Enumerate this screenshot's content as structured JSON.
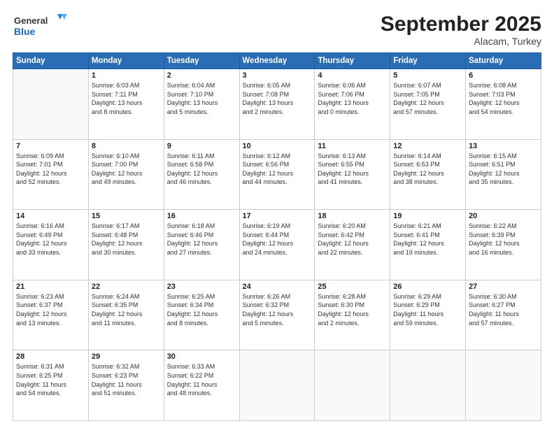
{
  "header": {
    "logo_line1": "General",
    "logo_line2": "Blue",
    "month": "September 2025",
    "location": "Alacam, Turkey"
  },
  "days_of_week": [
    "Sunday",
    "Monday",
    "Tuesday",
    "Wednesday",
    "Thursday",
    "Friday",
    "Saturday"
  ],
  "weeks": [
    [
      {
        "day": "",
        "info": ""
      },
      {
        "day": "1",
        "info": "Sunrise: 6:03 AM\nSunset: 7:11 PM\nDaylight: 13 hours\nand 8 minutes."
      },
      {
        "day": "2",
        "info": "Sunrise: 6:04 AM\nSunset: 7:10 PM\nDaylight: 13 hours\nand 5 minutes."
      },
      {
        "day": "3",
        "info": "Sunrise: 6:05 AM\nSunset: 7:08 PM\nDaylight: 13 hours\nand 2 minutes."
      },
      {
        "day": "4",
        "info": "Sunrise: 6:06 AM\nSunset: 7:06 PM\nDaylight: 13 hours\nand 0 minutes."
      },
      {
        "day": "5",
        "info": "Sunrise: 6:07 AM\nSunset: 7:05 PM\nDaylight: 12 hours\nand 57 minutes."
      },
      {
        "day": "6",
        "info": "Sunrise: 6:08 AM\nSunset: 7:03 PM\nDaylight: 12 hours\nand 54 minutes."
      }
    ],
    [
      {
        "day": "7",
        "info": "Sunrise: 6:09 AM\nSunset: 7:01 PM\nDaylight: 12 hours\nand 52 minutes."
      },
      {
        "day": "8",
        "info": "Sunrise: 6:10 AM\nSunset: 7:00 PM\nDaylight: 12 hours\nand 49 minutes."
      },
      {
        "day": "9",
        "info": "Sunrise: 6:11 AM\nSunset: 6:58 PM\nDaylight: 12 hours\nand 46 minutes."
      },
      {
        "day": "10",
        "info": "Sunrise: 6:12 AM\nSunset: 6:56 PM\nDaylight: 12 hours\nand 44 minutes."
      },
      {
        "day": "11",
        "info": "Sunrise: 6:13 AM\nSunset: 6:55 PM\nDaylight: 12 hours\nand 41 minutes."
      },
      {
        "day": "12",
        "info": "Sunrise: 6:14 AM\nSunset: 6:53 PM\nDaylight: 12 hours\nand 38 minutes."
      },
      {
        "day": "13",
        "info": "Sunrise: 6:15 AM\nSunset: 6:51 PM\nDaylight: 12 hours\nand 35 minutes."
      }
    ],
    [
      {
        "day": "14",
        "info": "Sunrise: 6:16 AM\nSunset: 6:49 PM\nDaylight: 12 hours\nand 33 minutes."
      },
      {
        "day": "15",
        "info": "Sunrise: 6:17 AM\nSunset: 6:48 PM\nDaylight: 12 hours\nand 30 minutes."
      },
      {
        "day": "16",
        "info": "Sunrise: 6:18 AM\nSunset: 6:46 PM\nDaylight: 12 hours\nand 27 minutes."
      },
      {
        "day": "17",
        "info": "Sunrise: 6:19 AM\nSunset: 6:44 PM\nDaylight: 12 hours\nand 24 minutes."
      },
      {
        "day": "18",
        "info": "Sunrise: 6:20 AM\nSunset: 6:42 PM\nDaylight: 12 hours\nand 22 minutes."
      },
      {
        "day": "19",
        "info": "Sunrise: 6:21 AM\nSunset: 6:41 PM\nDaylight: 12 hours\nand 19 minutes."
      },
      {
        "day": "20",
        "info": "Sunrise: 6:22 AM\nSunset: 6:39 PM\nDaylight: 12 hours\nand 16 minutes."
      }
    ],
    [
      {
        "day": "21",
        "info": "Sunrise: 6:23 AM\nSunset: 6:37 PM\nDaylight: 12 hours\nand 13 minutes."
      },
      {
        "day": "22",
        "info": "Sunrise: 6:24 AM\nSunset: 6:35 PM\nDaylight: 12 hours\nand 11 minutes."
      },
      {
        "day": "23",
        "info": "Sunrise: 6:25 AM\nSunset: 6:34 PM\nDaylight: 12 hours\nand 8 minutes."
      },
      {
        "day": "24",
        "info": "Sunrise: 6:26 AM\nSunset: 6:32 PM\nDaylight: 12 hours\nand 5 minutes."
      },
      {
        "day": "25",
        "info": "Sunrise: 6:28 AM\nSunset: 6:30 PM\nDaylight: 12 hours\nand 2 minutes."
      },
      {
        "day": "26",
        "info": "Sunrise: 6:29 AM\nSunset: 6:29 PM\nDaylight: 11 hours\nand 59 minutes."
      },
      {
        "day": "27",
        "info": "Sunrise: 6:30 AM\nSunset: 6:27 PM\nDaylight: 11 hours\nand 57 minutes."
      }
    ],
    [
      {
        "day": "28",
        "info": "Sunrise: 6:31 AM\nSunset: 6:25 PM\nDaylight: 11 hours\nand 54 minutes."
      },
      {
        "day": "29",
        "info": "Sunrise: 6:32 AM\nSunset: 6:23 PM\nDaylight: 11 hours\nand 51 minutes."
      },
      {
        "day": "30",
        "info": "Sunrise: 6:33 AM\nSunset: 6:22 PM\nDaylight: 11 hours\nand 48 minutes."
      },
      {
        "day": "",
        "info": ""
      },
      {
        "day": "",
        "info": ""
      },
      {
        "day": "",
        "info": ""
      },
      {
        "day": "",
        "info": ""
      }
    ]
  ]
}
